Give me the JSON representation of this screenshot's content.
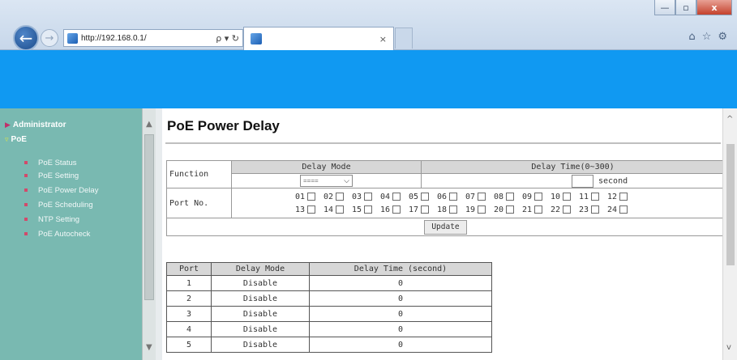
{
  "browser": {
    "address": "http://192.168.0.1/",
    "address_tools": "ρ ▾ ↻",
    "tab_close": "×",
    "win_min": "—",
    "win_max": "▫",
    "win_close": "x",
    "back": "←",
    "forward": "→",
    "home": "⌂",
    "favorites": "☆",
    "settings": "⚙"
  },
  "sidebar": {
    "top_items": [
      {
        "label": "Administrator",
        "mark": "▶"
      },
      {
        "label": "PoE",
        "mark": "▿"
      }
    ],
    "submenu": [
      "PoE Status",
      "PoE Setting",
      "PoE Power Delay",
      "PoE Scheduling",
      "NTP Setting",
      "PoE Autocheck"
    ]
  },
  "main": {
    "title": "PoE Power Delay",
    "config": {
      "function_label": "Function",
      "delay_mode_header": "Delay Mode",
      "delay_time_header": "Delay Time(0~300)",
      "delay_mode_value": "====",
      "second_label": "second",
      "port_label": "Port No.",
      "ports_row1": [
        "01",
        "02",
        "03",
        "04",
        "05",
        "06",
        "07",
        "08",
        "09",
        "10",
        "11",
        "12"
      ],
      "ports_row2": [
        "13",
        "14",
        "15",
        "16",
        "17",
        "18",
        "19",
        "20",
        "21",
        "22",
        "23",
        "24"
      ],
      "update_label": "Update"
    },
    "status": {
      "headers": [
        "Port",
        "Delay Mode",
        "Delay Time (second)"
      ],
      "rows": [
        [
          "1",
          "Disable",
          "0"
        ],
        [
          "2",
          "Disable",
          "0"
        ],
        [
          "3",
          "Disable",
          "0"
        ],
        [
          "4",
          "Disable",
          "0"
        ],
        [
          "5",
          "Disable",
          "0"
        ]
      ]
    }
  },
  "colors": {
    "banner": "#1099f2",
    "sidebar": "#79b9b1",
    "table_header": "#d7d7d7"
  }
}
